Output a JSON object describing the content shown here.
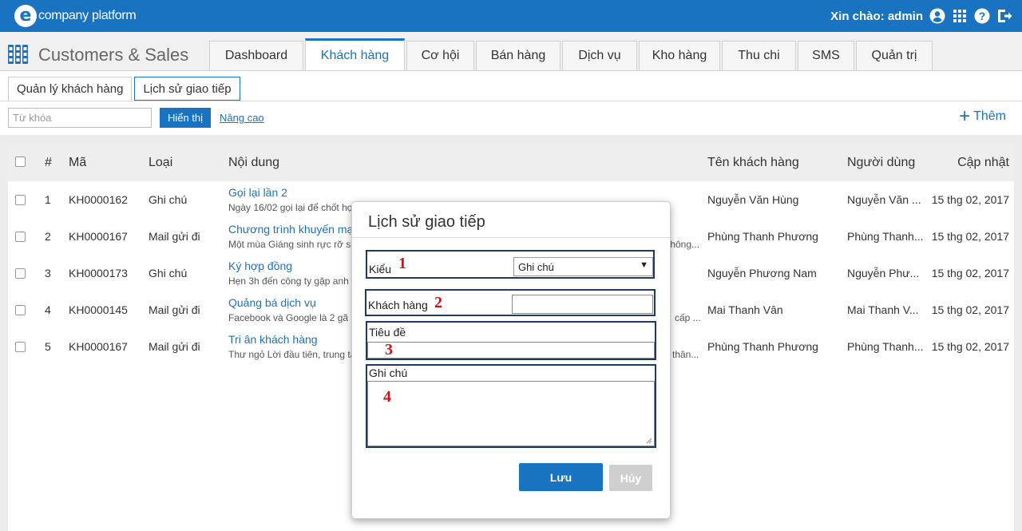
{
  "topbar": {
    "logo_mark": "e",
    "logo_text": "company platform",
    "greeting": "Xin chào: admin"
  },
  "header": {
    "app_title": "Customers & Sales",
    "tabs": [
      {
        "label": "Dashboard"
      },
      {
        "label": "Khách hàng",
        "active": true
      },
      {
        "label": "Cơ hội"
      },
      {
        "label": "Bán hàng"
      },
      {
        "label": "Dịch vụ"
      },
      {
        "label": "Kho hàng"
      },
      {
        "label": "Thu chi"
      },
      {
        "label": "SMS"
      },
      {
        "label": "Quản trị"
      }
    ]
  },
  "subtabs": [
    {
      "label": "Quản lý khách hàng"
    },
    {
      "label": "Lịch sử giao tiếp",
      "active": true
    }
  ],
  "toolbar": {
    "search_placeholder": "Từ khóa",
    "show_label": "Hiển thị",
    "advanced_label": "Nâng cao",
    "add_label": "Thêm"
  },
  "table": {
    "headers": {
      "num": "#",
      "code": "Mã",
      "type": "Loại",
      "content": "Nội dung",
      "customer": "Tên khách hàng",
      "user": "Người dùng",
      "updated": "Cập nhật"
    },
    "rows": [
      {
        "num": "1",
        "code": "KH0000162",
        "type": "Ghi chú",
        "title": "Gọi lại lần 2",
        "desc": "Ngày 16/02 gọi lại để chốt hợ",
        "desc_right": "",
        "customer": "Nguyễn Văn Hùng",
        "user": "Nguyễn Văn ...",
        "updated": "15 thg 02, 2017"
      },
      {
        "num": "2",
        "code": "KH0000167",
        "type": "Mail gửi đi",
        "title": "Chương trình khuyến mại",
        "desc": "Một mùa Giáng sinh rực rỡ sắ",
        "desc_right": "thông...",
        "customer": "Phùng Thanh Phương",
        "user": "Phùng Thanh...",
        "updated": "15 thg 02, 2017"
      },
      {
        "num": "3",
        "code": "KH0000173",
        "type": "Ghi chú",
        "title": "Ký hợp đồng",
        "desc": "Hẹn 3h đến công ty gặp anh H",
        "desc_right": "",
        "customer": "Nguyễn Phương Nam",
        "user": "Nguyễn Phư...",
        "updated": "15 thg 02, 2017"
      },
      {
        "num": "4",
        "code": "KH0000145",
        "type": "Mail gửi đi",
        "title": "Quảng bá dịch vụ",
        "desc": "Facebook và Google là 2 gã k",
        "desc_right": "cấp ...",
        "customer": "Mai Thanh Vân",
        "user": "Mai Thanh V...",
        "updated": "15 thg 02, 2017"
      },
      {
        "num": "5",
        "code": "KH0000167",
        "type": "Mail gửi đi",
        "title": "Tri ân khách hàng",
        "desc": "Thư ngỏ Lời đầu tiên, trung tâ",
        "desc_right": "thân...",
        "customer": "Phùng Thanh Phương",
        "user": "Phùng Thanh...",
        "updated": "15 thg 02, 2017"
      }
    ]
  },
  "modal": {
    "title": "Lịch sử giao tiếp",
    "type_label": "Kiểu",
    "type_value": "Ghi chú",
    "customer_label": "Khách hàng",
    "subject_label": "Tiêu đề",
    "note_label": "Ghi chú",
    "markers": [
      "1",
      "2",
      "3",
      "4"
    ],
    "save_label": "Lưu",
    "cancel_label": "Hủy"
  }
}
